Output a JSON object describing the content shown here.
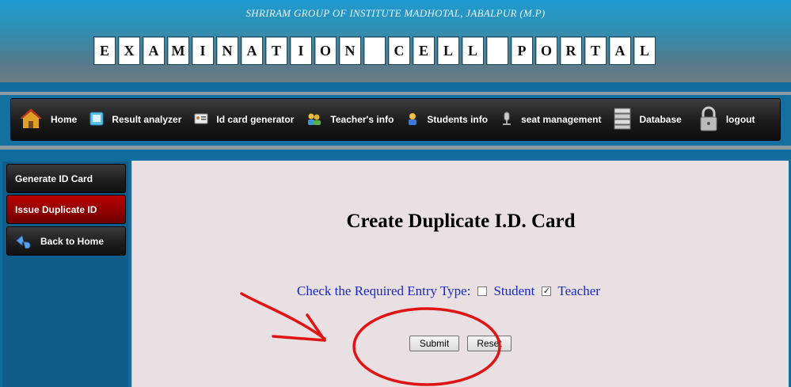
{
  "header": {
    "institute": "SHRIRAM GROUP OF INSTITUTE MADHOTAL, JABALPUR (M.P)",
    "title_tiles": [
      "E",
      "X",
      "A",
      "M",
      "I",
      "N",
      "A",
      "T",
      "I",
      "O",
      "N",
      " ",
      "C",
      "E",
      "L",
      "L",
      " ",
      "P",
      "O",
      "R",
      "T",
      "A",
      "L"
    ]
  },
  "nav": {
    "items": [
      {
        "label": "Home",
        "icon": "house-icon"
      },
      {
        "label": "Result analyzer",
        "icon": "calculator-icon"
      },
      {
        "label": "Id card generator",
        "icon": "id-card-icon"
      },
      {
        "label": "Teacher's info",
        "icon": "teacher-group-icon"
      },
      {
        "label": "Students info",
        "icon": "student-icon"
      },
      {
        "label": "seat management",
        "icon": "microphone-icon"
      },
      {
        "label": "Database",
        "icon": "database-icon"
      },
      {
        "label": "logout",
        "icon": "padlock-icon"
      }
    ]
  },
  "sidebar": {
    "items": [
      {
        "label": "Generate ID Card",
        "active": false
      },
      {
        "label": "Issue Duplicate ID",
        "active": true
      },
      {
        "label": "Back to Home",
        "active": false,
        "icon": "back-arrow-icon"
      }
    ]
  },
  "main": {
    "title": "Create Duplicate I.D. Card",
    "entry_prompt": "Check the Required Entry Type:",
    "options": [
      {
        "label": "Student",
        "checked": false
      },
      {
        "label": "Teacher",
        "checked": true
      }
    ],
    "submit_label": "Submit",
    "reset_label": "Reset"
  },
  "colors": {
    "annotation": "#e01414",
    "prompt_text": "#1a27c9",
    "active_sidebar": "#a00000"
  }
}
